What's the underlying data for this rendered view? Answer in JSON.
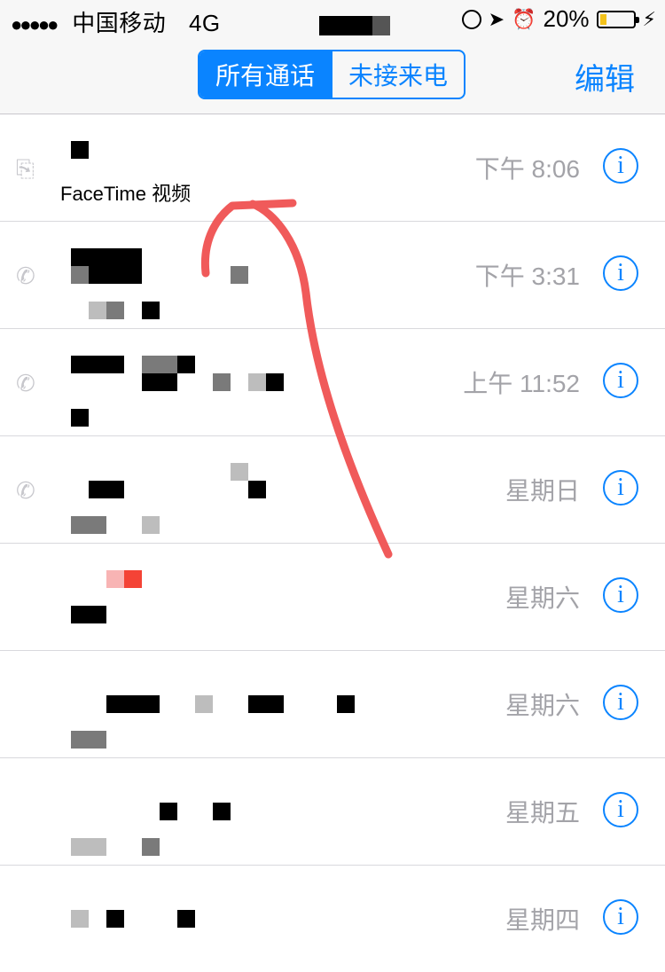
{
  "status_bar": {
    "signal_dots": "●●●●●",
    "carrier": "中国移动",
    "network": "4G",
    "battery": "20%",
    "battery_level": 0.2,
    "icons": [
      "orientation-lock-icon",
      "location-arrow-icon",
      "alarm-icon",
      "battery-icon",
      "charging-bolt-icon"
    ]
  },
  "nav": {
    "segments": [
      {
        "label": "所有通话",
        "active": true
      },
      {
        "label": "未接来电",
        "active": false
      }
    ],
    "edit_label": "编辑"
  },
  "calls": [
    {
      "name": "FaceTime 视频",
      "time": "下午 8:06",
      "type": "facetime-video-icon"
    },
    {
      "name": "",
      "time": "下午 3:31",
      "type": "phone-icon"
    },
    {
      "name": "",
      "time": "上午 11:52",
      "type": "phone-icon"
    },
    {
      "name": "",
      "time": "星期日",
      "type": "phone-icon"
    },
    {
      "name": "",
      "time": "星期六",
      "type": ""
    },
    {
      "name": "",
      "time": "星期六",
      "type": ""
    },
    {
      "name": "",
      "time": "星期五",
      "type": ""
    },
    {
      "name": "",
      "time": "星期四",
      "type": ""
    }
  ],
  "info_glyph": "i",
  "colors": {
    "accent": "#0a84ff",
    "annotation": "#f05a5a",
    "time_gray": "#a3a3a8"
  }
}
